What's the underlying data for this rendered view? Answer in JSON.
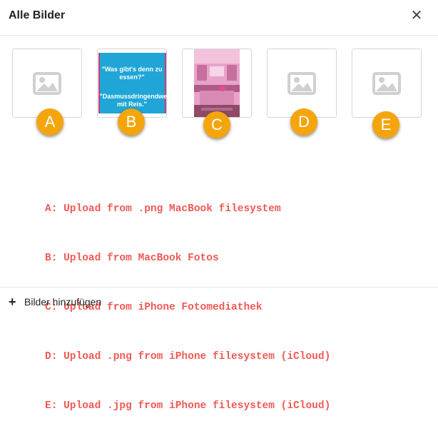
{
  "dialog": {
    "title": "Alle Bilder",
    "close_icon": "✕"
  },
  "images": [
    {
      "badge": "A",
      "kind": "placeholder"
    },
    {
      "badge": "B",
      "kind": "photo",
      "line1": "\"Was gibt's denn zu essen?\"",
      "line2": "\"Dasmussdringendweg mit Reis.\""
    },
    {
      "badge": "C",
      "kind": "photo"
    },
    {
      "badge": "D",
      "kind": "placeholder"
    },
    {
      "badge": "E",
      "kind": "placeholder"
    }
  ],
  "legend": [
    "A: Upload from .png MacBook filesystem",
    "B: Upload from MacBook Fotos",
    "C: Upload from iPhone Fotomediathek",
    "D: Upload .png from iPhone filesystem (iCloud)",
    "E: Upload .jpg from iPhone filesystem (iCloud)"
  ],
  "footer": {
    "plus_icon": "+",
    "add_label": "Bilder hinzufügen"
  },
  "colors": {
    "badge": "#f5a50c",
    "legend_text": "#ef5a55",
    "placeholder_icon": "#d0d0d0"
  }
}
